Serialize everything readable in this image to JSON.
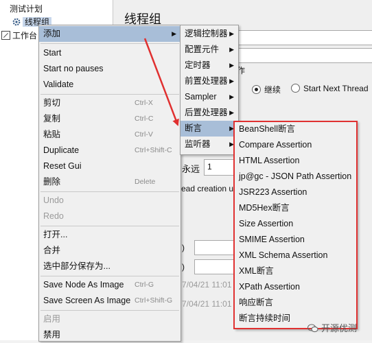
{
  "tree": {
    "test_plan": "测试计划",
    "thread_group": "线程组",
    "workbench": "工作台"
  },
  "panel": {
    "title": "线程组",
    "action_label_fragment": "作",
    "continue_radio": "继续",
    "start_next_thread_radio": "Start Next Thread",
    "forever_label": "永远",
    "loop_count_value": "1",
    "delay_creation_fragment": "ead creation u",
    "paren1": ")",
    "paren2": ")",
    "date1": "7/04/21 11:01",
    "date2": "7/04/21 11:01"
  },
  "context_menu": {
    "items": [
      {
        "label": "添加",
        "submenu": true,
        "highlighted": true
      },
      {
        "label": "Start"
      },
      {
        "label": "Start no pauses"
      },
      {
        "label": "Validate"
      },
      {
        "label": "剪切",
        "accelerator": "Ctrl-X"
      },
      {
        "label": "复制",
        "accelerator": "Ctrl-C"
      },
      {
        "label": "粘贴",
        "accelerator": "Ctrl-V"
      },
      {
        "label": "Duplicate",
        "accelerator": "Ctrl+Shift-C"
      },
      {
        "label": "Reset Gui"
      },
      {
        "label": "删除",
        "accelerator": "Delete"
      },
      {
        "label": "Undo",
        "disabled": true
      },
      {
        "label": "Redo",
        "disabled": true
      },
      {
        "label": "打开..."
      },
      {
        "label": "合并"
      },
      {
        "label": "选中部分保存为..."
      },
      {
        "label": "Save Node As Image",
        "accelerator": "Ctrl-G"
      },
      {
        "label": "Save Screen As Image",
        "accelerator": "Ctrl+Shift-G"
      },
      {
        "label": "启用",
        "disabled": true
      },
      {
        "label": "禁用"
      }
    ]
  },
  "add_submenu": {
    "items": [
      {
        "label": "逻辑控制器",
        "submenu": true
      },
      {
        "label": "配置元件",
        "submenu": true
      },
      {
        "label": "定时器",
        "submenu": true
      },
      {
        "label": "前置处理器",
        "submenu": true
      },
      {
        "label": "Sampler",
        "submenu": true
      },
      {
        "label": "后置处理器",
        "submenu": true
      },
      {
        "label": "断言",
        "submenu": true,
        "highlighted": true
      },
      {
        "label": "监听器",
        "submenu": true
      }
    ]
  },
  "assertion_submenu": {
    "items": [
      {
        "label": "BeanShell断言"
      },
      {
        "label": "Compare Assertion"
      },
      {
        "label": "HTML Assertion"
      },
      {
        "label": "jp@gc - JSON Path Assertion"
      },
      {
        "label": "JSR223 Assertion"
      },
      {
        "label": "MD5Hex断言"
      },
      {
        "label": "Size Assertion"
      },
      {
        "label": "SMIME Assertion"
      },
      {
        "label": "XML Schema Assertion"
      },
      {
        "label": "XML断言"
      },
      {
        "label": "XPath Assertion"
      },
      {
        "label": "响应断言"
      },
      {
        "label": "断言持续时间"
      }
    ]
  },
  "watermark": "开源优测",
  "colors": {
    "highlight": "#a8bed8",
    "annotation_red": "#e03030",
    "menu_bg": "#f0f0f0"
  }
}
